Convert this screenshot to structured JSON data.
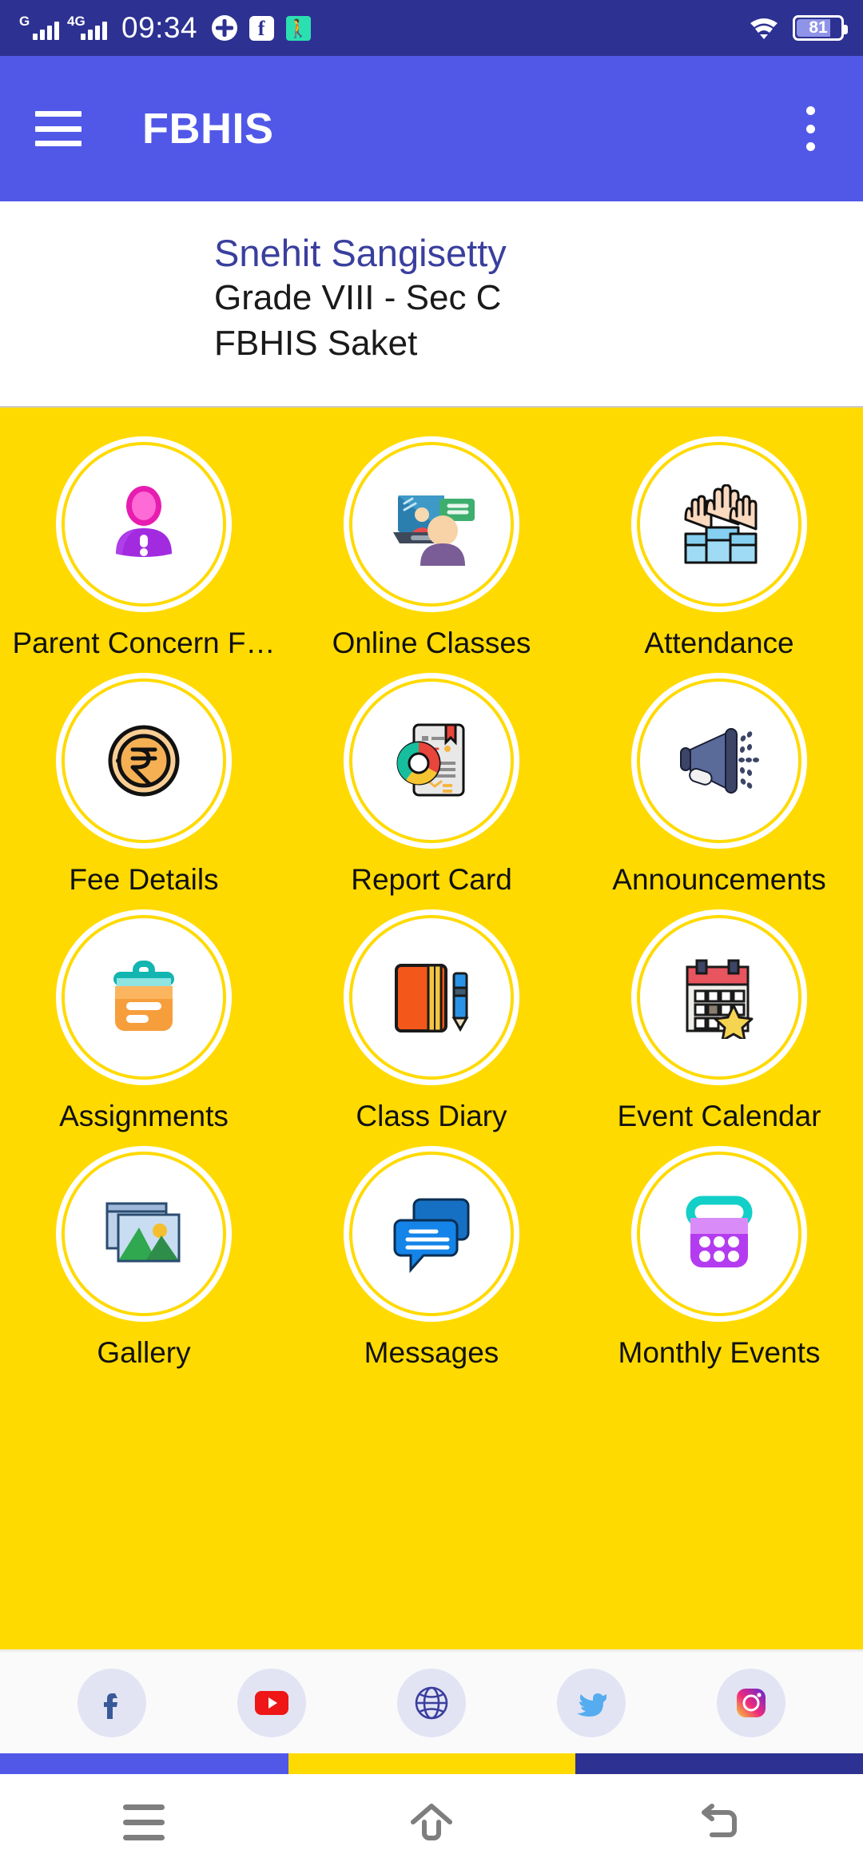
{
  "status_bar": {
    "network_label_1": "G",
    "network_label_2": "4G",
    "time": "09:34",
    "battery_percent": "81",
    "icons": [
      "flower-icon",
      "facebook-icon",
      "fitness-icon",
      "wifi-icon",
      "battery-icon"
    ]
  },
  "app_bar": {
    "title": "FBHIS",
    "menu_icon": "hamburger-icon",
    "overflow_icon": "kebab-menu-icon"
  },
  "student": {
    "name": "Snehit Sangisetty",
    "grade": "Grade VIII - Sec C",
    "school": "FBHIS Saket"
  },
  "colors": {
    "status_bar": "#2D3192",
    "app_bar": "#5158E8",
    "accent_yellow": "#FFDA00",
    "name_text": "#3A3F9E"
  },
  "grid": {
    "items": [
      {
        "label": "Parent Concern F…",
        "icon": "parent-concern-icon"
      },
      {
        "label": "Online Classes",
        "icon": "online-classes-icon"
      },
      {
        "label": "Attendance",
        "icon": "attendance-icon"
      },
      {
        "label": "Fee Details",
        "icon": "fee-details-icon"
      },
      {
        "label": "Report Card",
        "icon": "report-card-icon"
      },
      {
        "label": "Announcements",
        "icon": "announcements-icon"
      },
      {
        "label": "Assignments",
        "icon": "assignments-icon"
      },
      {
        "label": "Class Diary",
        "icon": "class-diary-icon"
      },
      {
        "label": "Event Calendar",
        "icon": "event-calendar-icon"
      },
      {
        "label": "Gallery",
        "icon": "gallery-icon"
      },
      {
        "label": "Messages",
        "icon": "messages-icon"
      },
      {
        "label": "Monthly Events",
        "icon": "monthly-events-icon"
      }
    ]
  },
  "social": {
    "items": [
      {
        "name": "facebook",
        "icon": "facebook-icon"
      },
      {
        "name": "youtube",
        "icon": "youtube-icon"
      },
      {
        "name": "website",
        "icon": "globe-icon"
      },
      {
        "name": "twitter",
        "icon": "twitter-icon"
      },
      {
        "name": "instagram",
        "icon": "instagram-icon"
      }
    ]
  },
  "nav_bar": {
    "recents": "recents-icon",
    "home": "home-icon",
    "back": "back-icon"
  }
}
